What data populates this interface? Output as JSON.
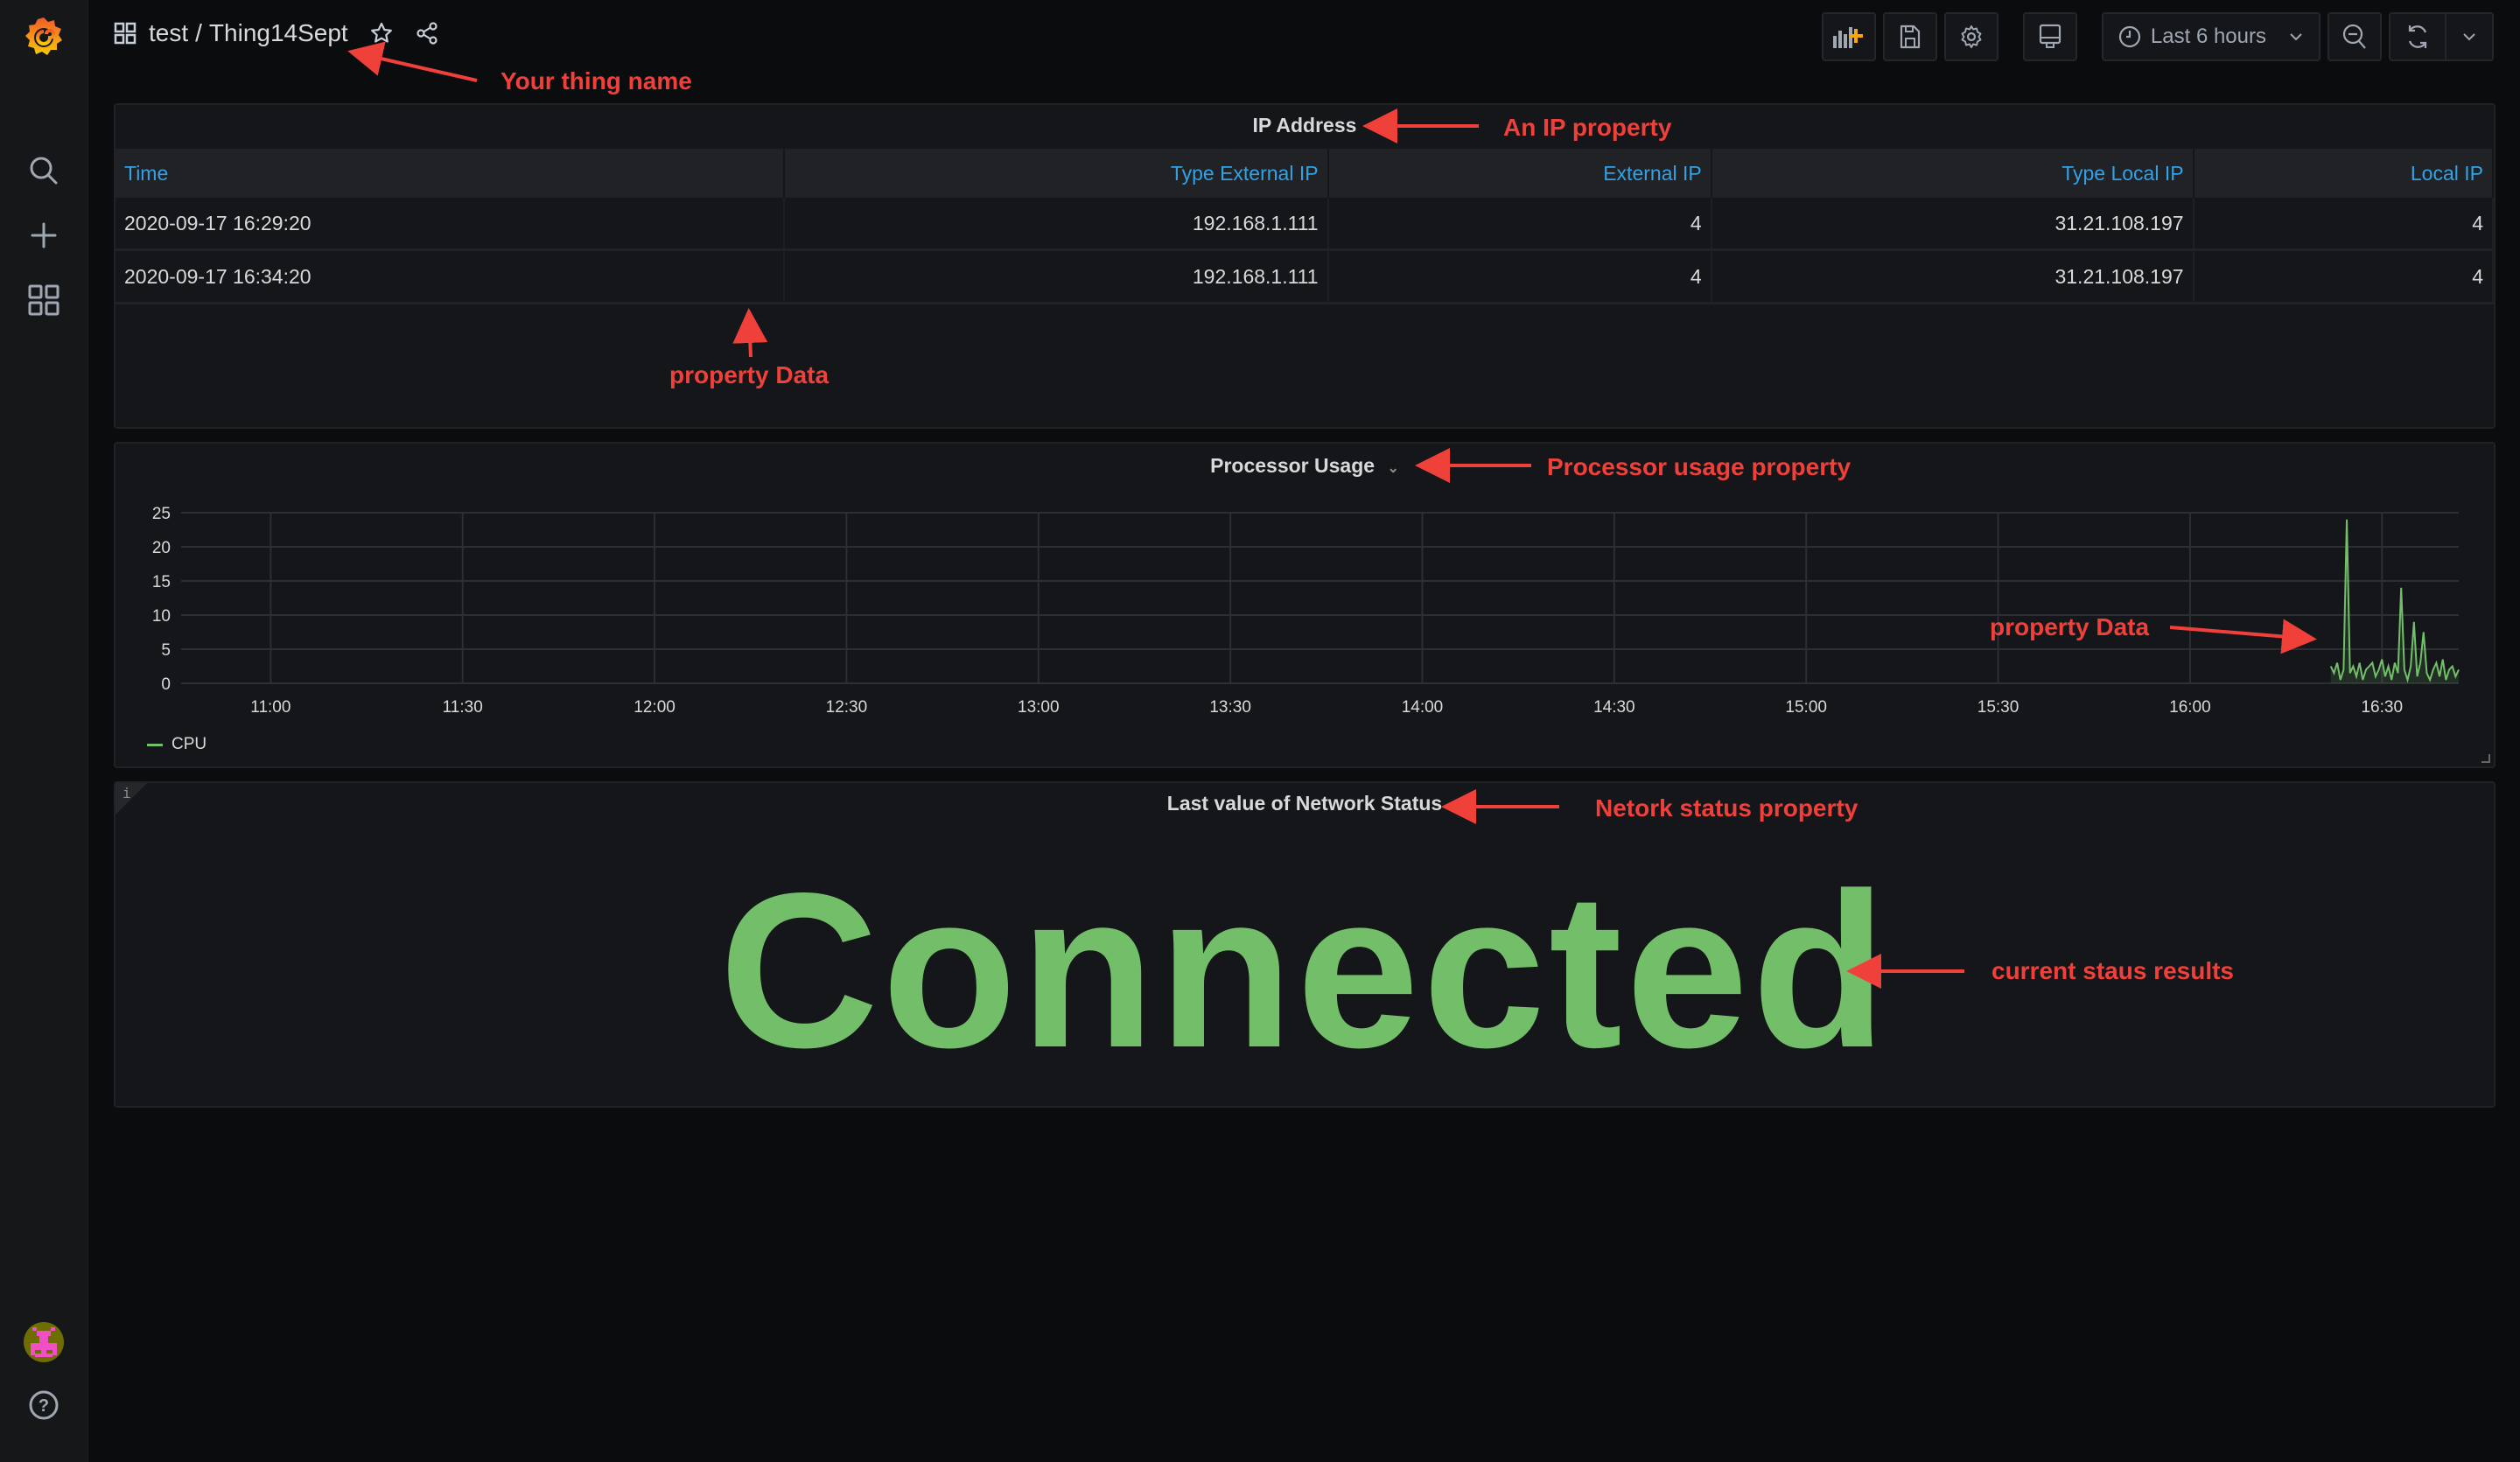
{
  "header": {
    "folder": "test",
    "separator": "/",
    "dashboard": "Thing14Sept",
    "toolbar": {
      "add_panel": "add-panel-icon",
      "save": "save-icon",
      "settings": "gear-icon",
      "tv_mode": "monitor-icon",
      "time_range": "Last 6 hours",
      "zoom_out": "zoom-out-icon",
      "refresh": "refresh-icon"
    }
  },
  "sidebar": {
    "items": [
      "grafana-logo",
      "search-icon",
      "plus-icon",
      "dashboards-icon"
    ],
    "bottom": [
      "user-avatar",
      "help-icon"
    ]
  },
  "ip_panel": {
    "title": "IP Address",
    "columns": [
      "Time",
      "Type External IP",
      "External IP",
      "Type Local IP",
      "Local IP"
    ],
    "rows": [
      [
        "2020-09-17 16:29:20",
        "192.168.1.111",
        "4",
        "31.21.108.197",
        "4"
      ],
      [
        "2020-09-17 16:34:20",
        "192.168.1.111",
        "4",
        "31.21.108.197",
        "4"
      ]
    ]
  },
  "chart_panel": {
    "title": "Processor Usage",
    "legend": "CPU"
  },
  "chart_data": {
    "type": "line",
    "title": "Processor Usage",
    "xlabel": "",
    "ylabel": "",
    "x_ticks": [
      "11:00",
      "11:30",
      "12:00",
      "12:30",
      "13:00",
      "13:30",
      "14:00",
      "14:30",
      "15:00",
      "15:30",
      "16:00",
      "16:30"
    ],
    "y_ticks": [
      0,
      5,
      10,
      15,
      20,
      25
    ],
    "ylim": [
      0,
      25
    ],
    "xlim": [
      "10:46",
      "16:42"
    ],
    "grid": true,
    "legend_position": "bottom-left",
    "series": [
      {
        "name": "CPU",
        "color": "#73bf69",
        "x": [
          "16:22",
          "16:22:30",
          "16:23",
          "16:23:30",
          "16:24",
          "16:24:30",
          "16:25",
          "16:25:30",
          "16:26",
          "16:26:30",
          "16:27",
          "16:27:30",
          "16:28",
          "16:28:30",
          "16:29",
          "16:29:30",
          "16:30",
          "16:30:30",
          "16:31",
          "16:31:30",
          "16:32",
          "16:32:30",
          "16:33",
          "16:33:30",
          "16:34",
          "16:34:30",
          "16:35",
          "16:35:30",
          "16:36",
          "16:36:30",
          "16:37",
          "16:37:30",
          "16:38",
          "16:38:30",
          "16:39",
          "16:39:30",
          "16:40",
          "16:40:30",
          "16:41",
          "16:41:30",
          "16:42"
        ],
        "values": [
          2.5,
          1.5,
          3,
          0.5,
          2,
          24,
          1.5,
          2.5,
          1,
          3,
          0.5,
          2,
          2.5,
          3,
          1,
          2,
          3.5,
          1,
          2.5,
          0.5,
          3,
          1.5,
          14,
          2,
          0.5,
          2.5,
          9,
          1,
          3,
          7.5,
          1.5,
          0.5,
          2,
          3,
          1,
          3.5,
          0.5,
          2,
          2.5,
          1,
          2
        ]
      }
    ]
  },
  "status_panel": {
    "title": "Last value of Network Status",
    "value": "Connected",
    "value_color": "#73bf69",
    "info_icon": "i"
  },
  "annotations": {
    "thing_name": "Your thing name",
    "ip_property": "An IP property",
    "property_data_1": "property Data",
    "processor_property": "Processor usage property",
    "property_data_2": "property Data",
    "network_property": "Netork status property",
    "status_results": "current staus results"
  }
}
